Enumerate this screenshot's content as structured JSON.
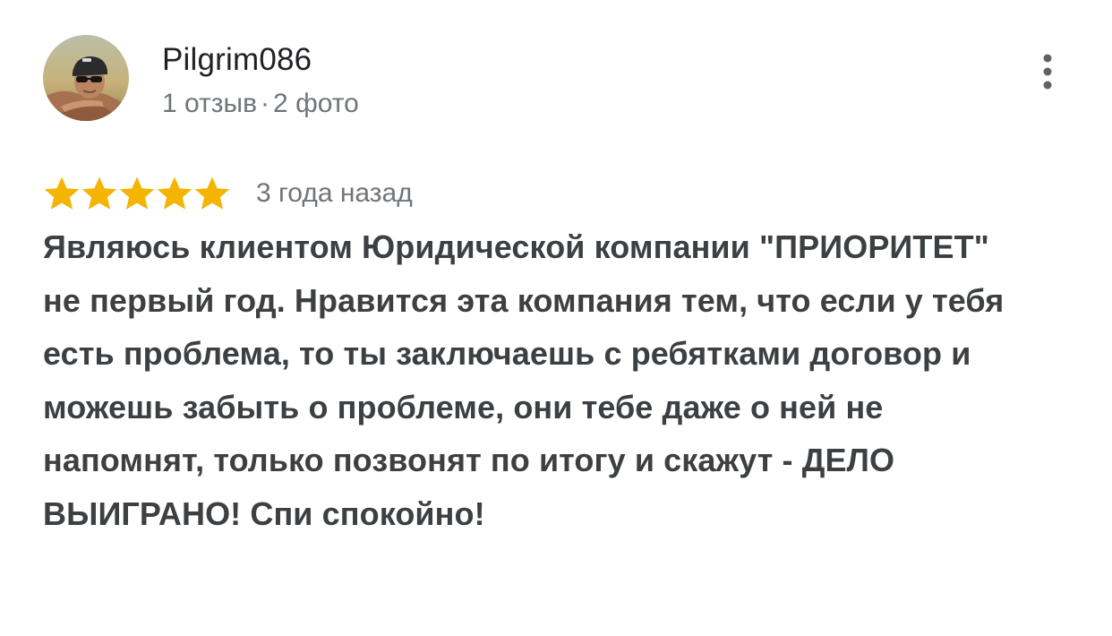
{
  "review": {
    "author": {
      "name": "Pilgrim086",
      "reviews_count": "1 отзыв",
      "separator": "·",
      "photos_count": "2 фото",
      "avatar_icon": "user-avatar-photo"
    },
    "menu_icon": "more-vertical-icon",
    "rating": {
      "stars": 5,
      "max_stars": 5,
      "star_icon": "star-icon",
      "star_color": "#f4b400"
    },
    "time_ago": "3 года назад",
    "text": "Являюсь клиентом Юридической компании \"ПРИОРИТЕТ\" не первый год. Нравится эта компания тем, что если у тебя есть проблема, то ты заключаешь с ребятками договор и можешь забыть о проблеме, они тебе даже о ней не напомнят, только позвонят по итогу и скажут - ДЕЛО ВЫИГРАНО! Спи спокойно!"
  },
  "colors": {
    "name": "#202124",
    "meta": "#70757a",
    "body_text": "#3c4043",
    "star": "#f4b400"
  }
}
